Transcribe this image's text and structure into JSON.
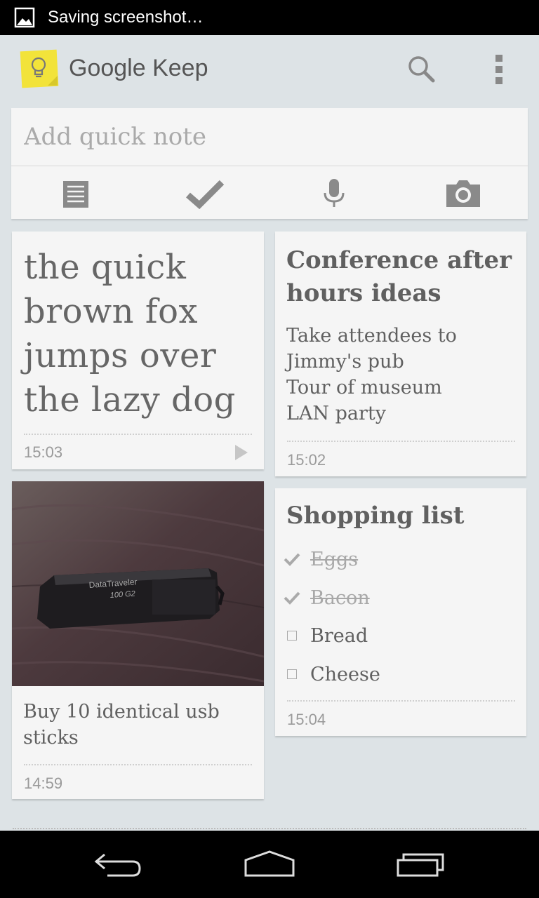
{
  "status": {
    "text": "Saving screenshot…"
  },
  "app": {
    "title": "Google Keep"
  },
  "quick_note": {
    "placeholder": "Add quick note"
  },
  "notes": {
    "note1": {
      "text": "the quick brown fox jumps over the lazy dog",
      "time": "15:03"
    },
    "note2": {
      "title": "Conference after hours ideas",
      "lines": [
        "Take attendees to",
        "Jimmy's pub",
        "Tour of museum",
        "LAN party"
      ],
      "time": "15:02"
    },
    "note3": {
      "caption": "Buy 10 identical usb sticks",
      "time": "14:59"
    },
    "note4": {
      "title": "Shopping list",
      "items": [
        {
          "label": "Eggs",
          "checked": true
        },
        {
          "label": "Bacon",
          "checked": true
        },
        {
          "label": "Bread",
          "checked": false
        },
        {
          "label": "Cheese",
          "checked": false
        }
      ],
      "time": "15:04"
    }
  },
  "photo": {
    "device_label": "DataTraveler",
    "model": "100 G2"
  },
  "colors": {
    "background": "#dde3e6",
    "card": "#f5f5f5",
    "logo": "#f6e840",
    "icon": "#8a8a8a"
  }
}
